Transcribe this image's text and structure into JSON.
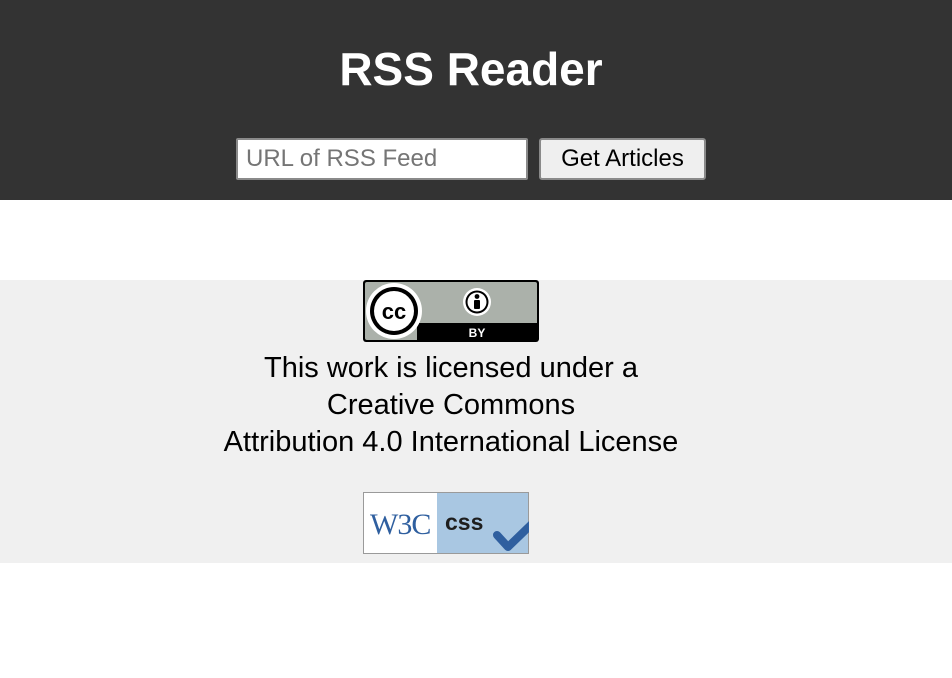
{
  "header": {
    "title": "RSS Reader",
    "feed_input": {
      "value": "",
      "placeholder": "URL of RSS Feed"
    },
    "get_articles_label": "Get Articles"
  },
  "footer": {
    "cc_badge": {
      "icon": "cc-by-license-icon",
      "text_left": "cc",
      "text_right": "BY"
    },
    "license_lines": [
      "This work is licensed under a",
      "Creative Commons",
      "Attribution 4.0 International License"
    ],
    "w3c_badge": {
      "icon": "w3c-css-valid-icon",
      "brand": "W3C",
      "label": "css"
    }
  },
  "colors": {
    "header_bg": "#333333",
    "footer_bg": "#f0f0f0",
    "w3c_blue": "#2f5f9f",
    "w3c_panel": "#a9c7e2"
  }
}
